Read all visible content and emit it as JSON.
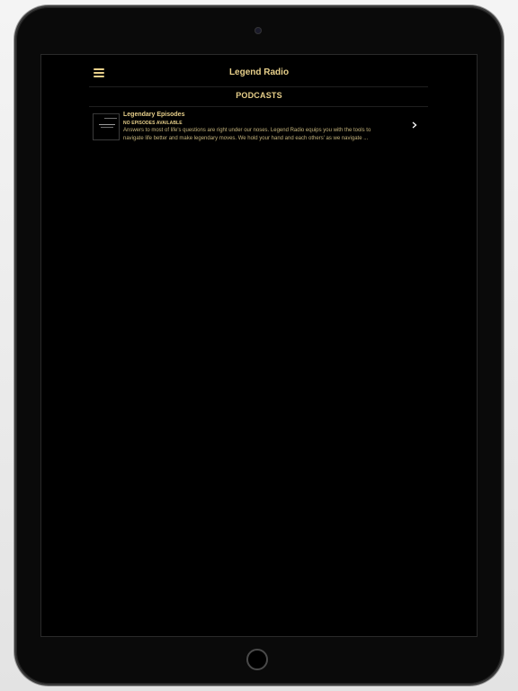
{
  "app": {
    "title": "Legend Radio"
  },
  "section": {
    "title": "PODCASTS"
  },
  "podcasts": [
    {
      "title": "Legendary Episodes",
      "status": "NO EPISODES AVAILABLE",
      "description_line1": "Answers to most of life's questions are right under our noses. Legend Radio equips you with the tools to",
      "description_line2": "navigate life better and make legendary moves. We hold your hand and each others' as we navigate ..."
    }
  ],
  "icons": {
    "menu": "hamburger-menu-icon",
    "chevron": "chevron-right-icon"
  },
  "colors": {
    "accent": "#e7cf8a",
    "background": "#000000"
  }
}
